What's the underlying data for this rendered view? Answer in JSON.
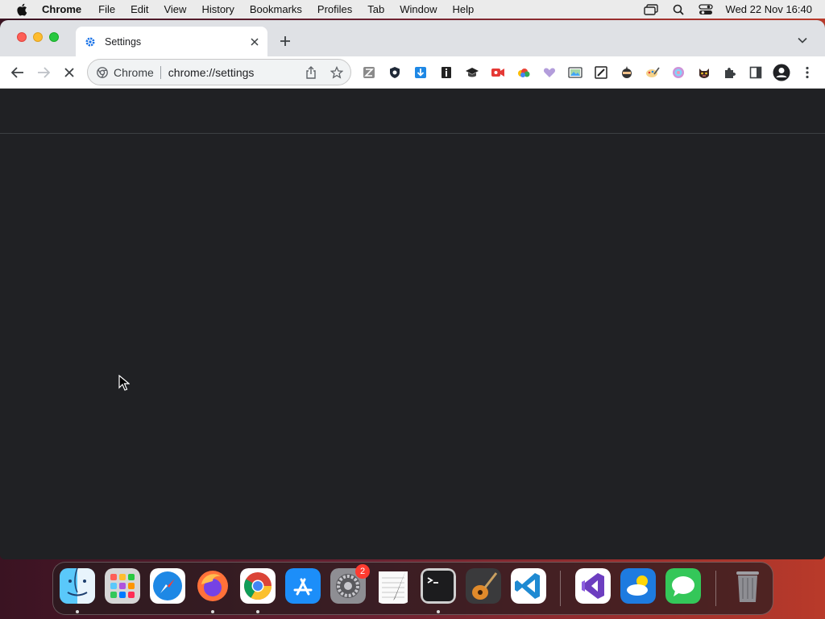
{
  "menubar": {
    "apple_icon": "apple-logo-icon",
    "app_name": "Chrome",
    "items": [
      "File",
      "Edit",
      "View",
      "History",
      "Bookmarks",
      "Profiles",
      "Tab",
      "Window",
      "Help"
    ],
    "status_icons": [
      "window-overlap-icon",
      "search-icon",
      "control-center-icon"
    ],
    "clock": "Wed 22 Nov  16:40"
  },
  "tab": {
    "title": "Settings",
    "favicon": "settings-gear-icon"
  },
  "toolbar": {
    "chip_label": "Chrome",
    "url": "chrome://settings",
    "extensions": [
      "zotero-icon",
      "shield-icon",
      "download-icon",
      "info-icon",
      "graduation-cap-icon",
      "video-record-icon",
      "cloud-colors-icon",
      "heart-icon",
      "image-gallery-icon",
      "edit-box-icon",
      "ninja-icon",
      "paint-icon",
      "globe-colors-icon",
      "cat-face-icon",
      "puzzle-icon",
      "sidebar-icon",
      "profile-icon",
      "more-vertical-icon"
    ]
  },
  "dock": {
    "apps": [
      "finder",
      "launchpad",
      "safari",
      "firefox",
      "chrome",
      "app-store",
      "system-preferences",
      "textedit",
      "terminal",
      "garageband",
      "vscode",
      "visual-studio",
      "weather",
      "messages",
      "trash"
    ],
    "system_preferences_badge": "2"
  },
  "colors": {
    "page_bg": "#202124",
    "toolbar_bg": "#ffffff",
    "tabstrip_bg": "#dfe1e5",
    "accent_blue": "#1a73e8"
  }
}
